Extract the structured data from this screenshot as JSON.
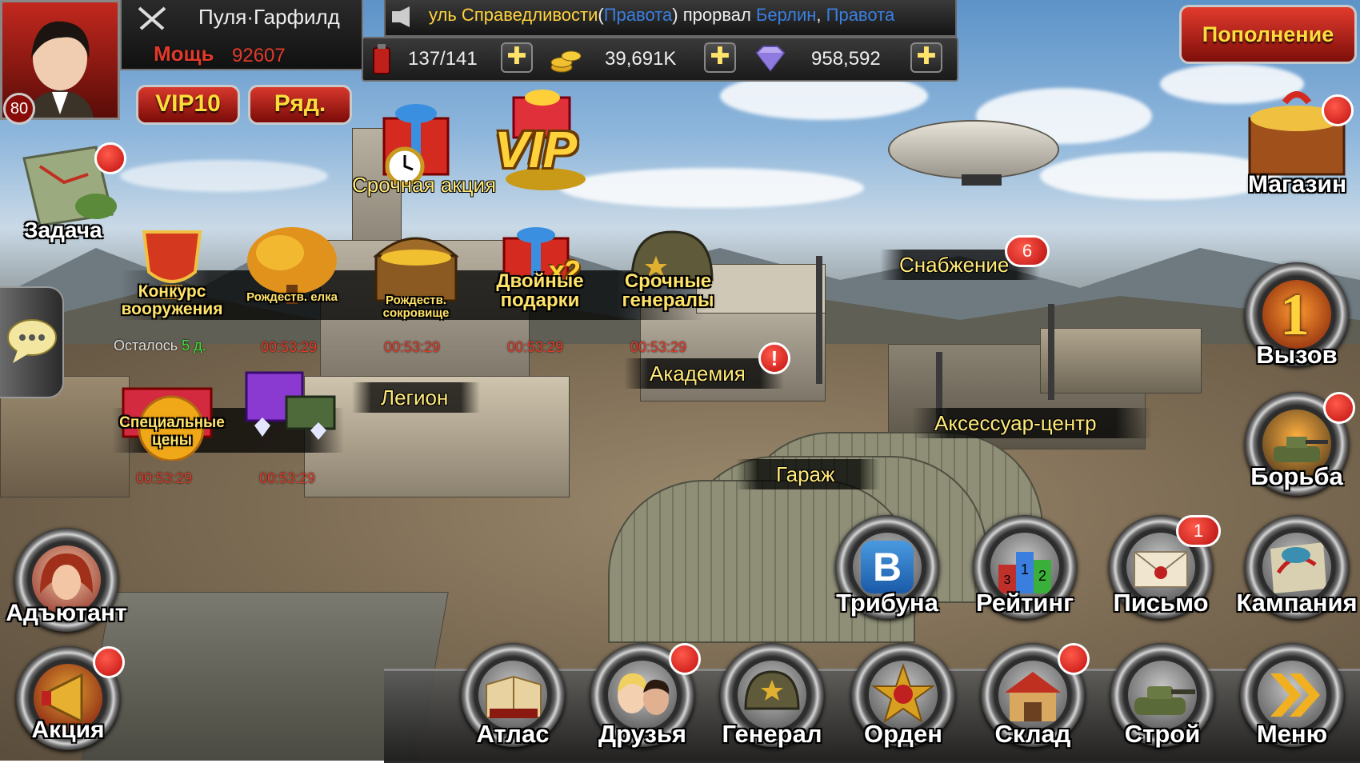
{
  "player": {
    "name": "Пуля·Гарфилд",
    "power_label": "Мощь",
    "power_value": "92607",
    "level": "80",
    "vip_label": "VIP10",
    "rank_label": "Ряд."
  },
  "ticker": {
    "part1": "уль Справедливости",
    "bracket_open": "(",
    "link1": "Правота",
    "bracket_close": ")",
    "part2": " прорвал ",
    "link2": "Берлин",
    "comma": ", ",
    "link3": "Правота"
  },
  "resources": {
    "fuel": "137/141",
    "gold": "39,691K",
    "diamonds": "958,592",
    "plus": "✚"
  },
  "recharge_label": "Пополнение",
  "events": {
    "urgent_action": "Срочная акция",
    "vip": "VIP",
    "weapons_contest": "Конкурс вооружения",
    "xmas_tree": "Рождеств. елка",
    "xmas_treasure": "Рождеств. сокровище",
    "double_gifts": "Двойные подарки",
    "double_x": "x2",
    "urgent_generals": "Срочные генералы",
    "remaining": "Осталось",
    "remaining_days": "5 д.",
    "special_prices": "Специальные цены",
    "timers": [
      "00:53:29",
      "00:53:29",
      "00:53:29",
      "00:53:29",
      "00:53:29",
      "00:53:29"
    ]
  },
  "map_labels": {
    "supply": "Снабжение",
    "supply_badge": "6",
    "academy": "Академия",
    "legion": "Легион",
    "accessory": "Аксессуар-центр",
    "garage": "Гараж"
  },
  "left": {
    "task": "Задача",
    "adjutant": "Адъютант",
    "promo": "Акция"
  },
  "right": {
    "shop": "Магазин",
    "challenge": "Вызов",
    "challenge_num": "1",
    "fight": "Борьба",
    "campaign": "Кампания",
    "letter": "Письмо",
    "letter_badge": "1",
    "rating": "Рейтинг",
    "tribune": "Трибуна",
    "vk": "B"
  },
  "bottom": {
    "atlas": "Атлас",
    "friends": "Друзья",
    "general": "Генерал",
    "order": "Орден",
    "warehouse": "Склад",
    "formation": "Строй",
    "menu": "Меню"
  },
  "colors": {
    "accent_red": "#c01010",
    "gold_text": "#ffdc3c",
    "label_yellow": "#ffe97a",
    "timer_red": "#e23a2a",
    "link_blue": "#3a7fe0"
  }
}
